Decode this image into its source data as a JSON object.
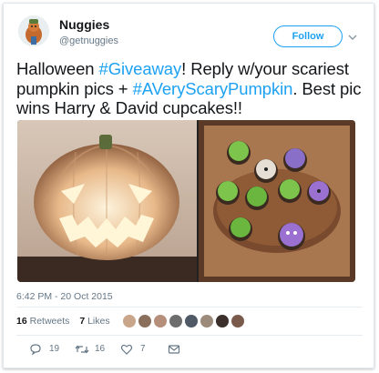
{
  "user": {
    "name": "Nuggies",
    "handle": "@getnuggies"
  },
  "follow_label": "Follow",
  "tweet": {
    "part1": "Halloween ",
    "hashtag1": "#Giveaway",
    "part2": "! Reply w/your scariest pumpkin pics + ",
    "hashtag2": "#AVeryScaryPumpkin",
    "part3": ". Best pic wins Harry & David cupcakes!!"
  },
  "media": {
    "left": "jack-o-lantern photo",
    "right": "halloween cupcakes photo"
  },
  "timestamp": "6:42 PM - 20 Oct 2015",
  "stats": {
    "retweets_count": "16",
    "retweets_label": "Retweets",
    "likes_count": "7",
    "likes_label": "Likes"
  },
  "likers": [
    "#c9a58a",
    "#8a6f5c",
    "#b58f7a",
    "#6d6d6d",
    "#4f5a66",
    "#9c8a7a",
    "#3a2f2a",
    "#7a5a4a"
  ],
  "actions": {
    "reply_count": "19",
    "retweet_count": "16",
    "like_count": "7"
  },
  "colors": {
    "accent": "#1da1f2",
    "muted": "#657786"
  }
}
